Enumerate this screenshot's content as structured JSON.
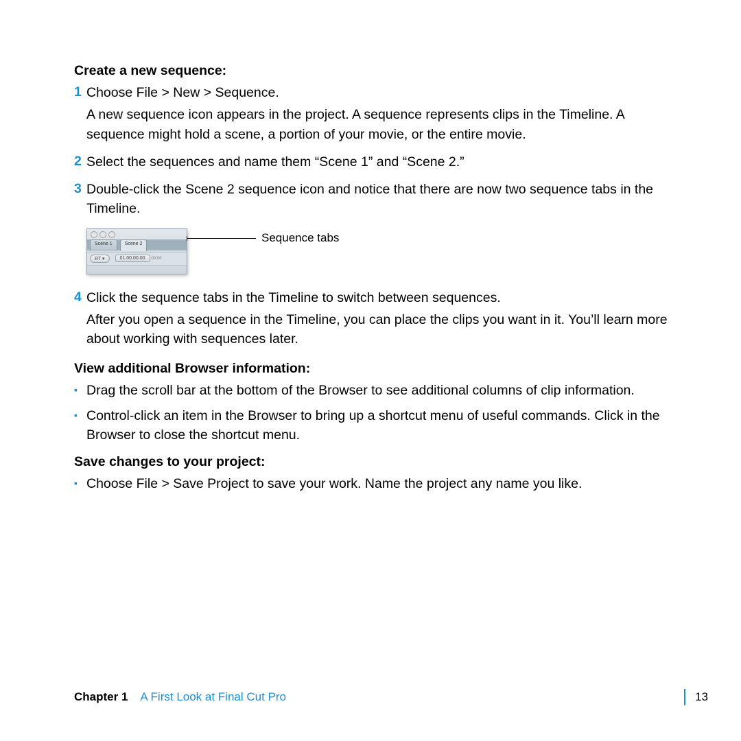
{
  "sections": {
    "s1": {
      "heading": "Create a new sequence:",
      "items": [
        {
          "num": "1",
          "p1": "Choose File > New > Sequence.",
          "p2": "A new sequence icon appears in the project. A sequence represents clips in the Timeline. A sequence might hold a scene, a portion of your movie, or the entire movie."
        },
        {
          "num": "2",
          "p1": "Select the sequences and name them “Scene 1” and “Scene 2.”"
        },
        {
          "num": "3",
          "p1": "Double-click the Scene 2 sequence icon and notice that there are now two sequence tabs in the Timeline."
        }
      ],
      "figure": {
        "tab1": "Scene 1",
        "tab2": "Scene 2",
        "rt": "RT ▾",
        "tc": "01:00:00:00",
        "sm": "00;00",
        "caption": "Sequence tabs"
      },
      "items2": [
        {
          "num": "4",
          "p1": "Click the sequence tabs in the Timeline to switch between sequences.",
          "p2": "After you open a sequence in the Timeline, you can place the clips you want in it. You’ll learn more about working with sequences later."
        }
      ]
    },
    "s2": {
      "heading": "View additional Browser information:",
      "bullets": [
        "Drag the scroll bar at the bottom of the Browser to see additional columns of clip information.",
        "Control-click an item in the Browser to bring up a shortcut menu of useful commands. Click in the Browser to close the shortcut menu."
      ]
    },
    "s3": {
      "heading": "Save changes to your project:",
      "bullets": [
        "Choose File > Save Project to save your work. Name the project any name you like."
      ]
    }
  },
  "footer": {
    "chapter": "Chapter 1",
    "title": "A First Look at Final Cut Pro",
    "page": "13"
  }
}
